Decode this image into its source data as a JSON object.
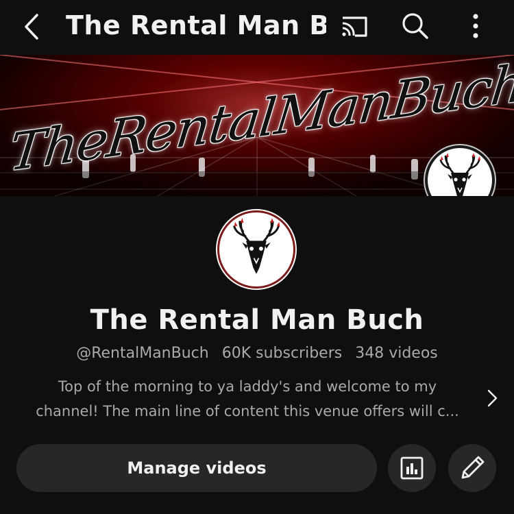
{
  "header": {
    "title": "The Rental Man B...",
    "icons": [
      "back-icon",
      "cast-icon",
      "search-icon",
      "more-vertical-icon"
    ]
  },
  "banner": {
    "text": "TheRentalManBuch",
    "logo_icon": "deer-skull-logo"
  },
  "channel": {
    "name": "The Rental Man Buch",
    "handle": "@RentalManBuch",
    "subscribers": "60K subscribers",
    "videos": "348 videos",
    "description_line1": "Top of the morning to ya laddy's and welcome to my",
    "description_line2": "channel! The main line of content this venue offers will c..."
  },
  "actions": {
    "manage_videos_label": "Manage videos",
    "analytics_icon": "analytics-icon",
    "edit_icon": "pencil-icon"
  },
  "colors": {
    "background": "#0f0f0f",
    "button_bg": "#272727",
    "text_primary": "#f1f1f1",
    "text_secondary": "#aaaaaa",
    "banner_accent": "#c00000"
  }
}
